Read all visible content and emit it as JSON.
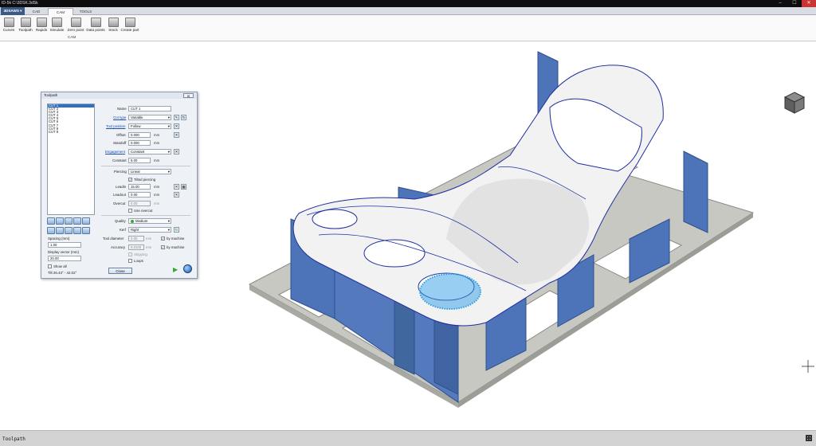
{
  "window": {
    "title": "ID-5k C:\\3DSK.3dSk",
    "buttons": [
      "–",
      "☐",
      "✕"
    ]
  },
  "menu": {
    "main": "3DSAWS ▾",
    "tabs": [
      "CAD",
      "CAM",
      "TOOLS"
    ],
    "active_tab": "CAM"
  },
  "ribbon": {
    "group": "CAM",
    "buttons": [
      "Curves",
      "Toolpath",
      "Rapids",
      "Simulate",
      "Zero point",
      "Data points",
      "Stock",
      "Create part"
    ]
  },
  "dialog": {
    "title": "Toolpath",
    "close_x": "☒",
    "cuts": [
      "CUT 1",
      "CUT 2",
      "CUT 3",
      "CUT 4",
      "CUT 5",
      "CUT 6",
      "CUT 7",
      "CUT 8",
      "CUT 9"
    ],
    "selected_cut": "CUT 1",
    "name_label": "Name",
    "name_value": "CUT 1",
    "cut_type_label": "Cut type",
    "cut_type_value": "Variable",
    "tool_position_label": "Tool position",
    "tool_position_value": "Follow",
    "offset_label": "Offset",
    "offset_value": "0.000",
    "offset_unit": "mm",
    "standoff_label": "Standoff",
    "standoff_value": "0.000",
    "standoff_unit": "mm",
    "engagement_label": "Engagement",
    "engagement_value": "Constant",
    "constant_label": "Constant",
    "constant_value": "5.00",
    "constant_unit": "mm",
    "piercing_label": "Piercing",
    "piercing_value": "Linear",
    "tilted_piercing_label": "Tilted piercing",
    "leadin_label": "Leadin",
    "leadin_value": "15.00",
    "leadin_unit": "mm",
    "leadout_label": "Leadout",
    "leadout_value": "0.00",
    "leadout_unit": "mm",
    "use_overcut_label": "Use overcut",
    "overcut_label": "Overcut",
    "overcut_value": "0.00",
    "overcut_unit": "mm",
    "quality_label": "Quality",
    "quality_value": "Medium",
    "kerf_label": "Kerf",
    "kerf_value": "Right",
    "tool_diameter_label": "Tool diameter",
    "tool_diameter_value": "0.00",
    "tool_diameter_unit": "mm",
    "by_machine_label": "by machine",
    "accuracy_label": "Accuracy",
    "accuracy_value": "0.0100",
    "accuracy_unit": "mm",
    "skipping_label": "Skipping",
    "loops_label": "Loops",
    "spacing_label": "Spacing (mm)",
    "spacing_value": "1.00",
    "display_vector_label": "Display vector (mm)",
    "display_vector_value": "20.00",
    "show_all_label": "Show all",
    "tilt_text": "Tilt 26.43° - 42.02°",
    "close_label": "Close"
  },
  "status": {
    "text": "Toolpath"
  },
  "colors": {
    "part": "#f2f2f2",
    "fixture": "#4d74b8",
    "base": "#c8c8c3",
    "path": "#1e2fa0",
    "selection": "#2f9de3"
  }
}
